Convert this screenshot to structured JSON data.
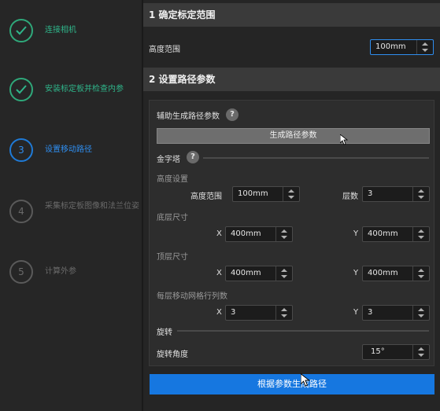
{
  "steps": [
    {
      "number": "✓",
      "label": "连接相机"
    },
    {
      "number": "✓",
      "label": "安装标定板并检查内参"
    },
    {
      "number": "3",
      "label": "设置移动路径"
    },
    {
      "number": "4",
      "label": "采集标定板图像和法兰位姿"
    },
    {
      "number": "5",
      "label": "计算外参"
    }
  ],
  "section1": {
    "title": "1 确定标定范围",
    "height_range_label": "高度范围",
    "height_range_value": "100mm"
  },
  "section2": {
    "title": "2 设置路径参数",
    "assist_label": "辅助生成路径参数",
    "generate_params_button": "生成路径参数",
    "pyramid_label": "金字塔",
    "height_settings_label": "高度设置",
    "height_range_label": "高度范围",
    "height_range_value": "100mm",
    "layers_label": "层数",
    "layers_value": "3",
    "bottom_size_label": "底层尺寸",
    "bottom_x_label": "X",
    "bottom_x_value": "400mm",
    "bottom_y_label": "Y",
    "bottom_y_value": "400mm",
    "top_size_label": "顶层尺寸",
    "top_x_label": "X",
    "top_x_value": "400mm",
    "top_y_label": "Y",
    "top_y_value": "400mm",
    "grid_label": "每层移动网格行列数",
    "grid_x_label": "X",
    "grid_x_value": "3",
    "grid_y_label": "Y",
    "grid_y_value": "3",
    "rotation_label": "旋转",
    "rotation_angle_label": "旋转角度",
    "rotation_angle_value": "15°"
  },
  "generate_path_button": "根据参数生成路径",
  "help_glyph": "?",
  "icons": {
    "check": "check-icon",
    "help": "help-icon",
    "cursor": "mouse-cursor-icon"
  },
  "colors": {
    "done": "#2fa87a",
    "active": "#2f8ef0",
    "todo": "#6a6a6a",
    "primary": "#1677e0"
  }
}
